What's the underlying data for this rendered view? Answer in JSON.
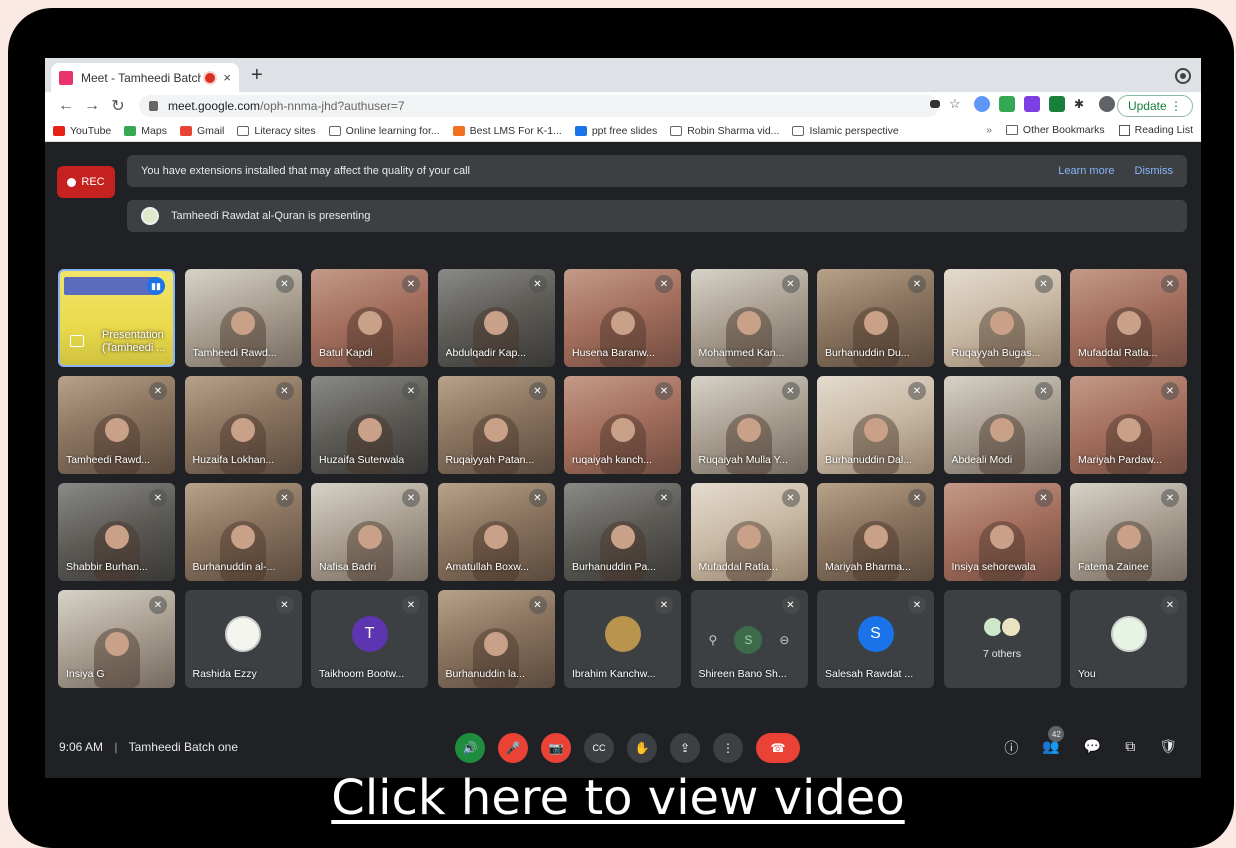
{
  "browser": {
    "tab_title": "Meet - Tamheedi Batch one",
    "tab_close": "×",
    "new_tab": "+",
    "url_host": "meet.google.com",
    "url_path": "/oph-nnma-jhd?authuser=7",
    "update_label": "Update",
    "bookmarks": [
      {
        "label": "YouTube",
        "icon": "youtube-icon",
        "color": "#e62117"
      },
      {
        "label": "Maps",
        "icon": "maps-icon",
        "color": "#34a853"
      },
      {
        "label": "Gmail",
        "icon": "gmail-icon",
        "color": "#ea4335"
      },
      {
        "label": "Literacy sites",
        "icon": "folder-icon"
      },
      {
        "label": "Online learning for...",
        "icon": "folder-icon"
      },
      {
        "label": "Best LMS For K-1...",
        "icon": "site-icon",
        "color": "#f37021"
      },
      {
        "label": "ppt free slides",
        "icon": "site-icon",
        "color": "#1a73e8"
      },
      {
        "label": "Robin Sharma vid...",
        "icon": "folder-icon"
      },
      {
        "label": "Islamic perspective",
        "icon": "folder-icon"
      }
    ],
    "bookmarks_overflow": "»",
    "other_bookmarks": "Other Bookmarks",
    "reading_list": "Reading List"
  },
  "meet": {
    "rec_label": "REC",
    "extension_notice": "You have extensions installed that may affect the quality of your call",
    "learn_more": "Learn more",
    "dismiss": "Dismiss",
    "presenting_notice": "Tamheedi Rawdat al-Quran is presenting",
    "presentation_tile_label": "Presentation (Tamheedi ...",
    "participants": [
      {
        "name": "Tamheedi Rawd...",
        "style": "v2"
      },
      {
        "name": "Batul Kapdi",
        "style": "v3"
      },
      {
        "name": "Abdulqadir Kap...",
        "style": "v4"
      },
      {
        "name": "Husena Baranw...",
        "style": "v3"
      },
      {
        "name": "Mohammed Kan...",
        "style": "v2"
      },
      {
        "name": "Burhanuddin Du...",
        "style": "v1"
      },
      {
        "name": "Ruqayyah Bugas...",
        "style": "v5"
      },
      {
        "name": "Mufaddal Ratla...",
        "style": "v3"
      },
      {
        "name": "Tamheedi Rawd...",
        "style": "v1"
      },
      {
        "name": "Huzaifa Lokhan...",
        "style": "v1"
      },
      {
        "name": "Huzaifa Suterwala",
        "style": "v4"
      },
      {
        "name": "Ruqaiyyah Patan...",
        "style": "v1"
      },
      {
        "name": "ruqaiyah kanch...",
        "style": "v3"
      },
      {
        "name": "Ruqaiyah Mulla Y...",
        "style": "v2"
      },
      {
        "name": "Burhanuddin Dal...",
        "style": "v5"
      },
      {
        "name": "Abdeali Modi",
        "style": "v2"
      },
      {
        "name": "Mariyah Pardaw...",
        "style": "v3"
      },
      {
        "name": "Shabbir Burhan...",
        "style": "v4"
      },
      {
        "name": "Burhanuddin al-...",
        "style": "v1"
      },
      {
        "name": "Nafisa Badri",
        "style": "v2"
      },
      {
        "name": "Amatullah Boxw...",
        "style": "v1"
      },
      {
        "name": "Burhanuddin Pa...",
        "style": "v4"
      },
      {
        "name": "Mufaddal Ratla...",
        "style": "v5"
      },
      {
        "name": "Mariyah Bharma...",
        "style": "v1"
      },
      {
        "name": "Insiya sehorewala",
        "style": "v3"
      },
      {
        "name": "Fatema Zainee",
        "style": "v2"
      },
      {
        "name": "Insiya G",
        "style": "v2"
      }
    ],
    "avatar_tiles": {
      "rashida": "Rashida Ezzy",
      "taikhoom": "Taikhoom Bootw...",
      "taikhoom_initial": "T",
      "burhanuddin_la": "Burhanuddin la...",
      "ibrahim": "Ibrahim Kanchw...",
      "shireen": "Shireen Bano Sh...",
      "shireen_initial": "S",
      "salesah": "Salesah Rawdat ...",
      "salesah_initial": "S",
      "others": "7 others",
      "you": "You"
    },
    "time": "9:06 AM",
    "meeting_name": "Tamheedi Batch one",
    "participant_count": "42"
  },
  "overlay": {
    "video_link": "Click here to view video"
  },
  "colors": {
    "meet_bg": "#202124",
    "tile_bg": "#3c4043",
    "rec_red": "#c5221f",
    "link_blue": "#8ab4f8",
    "end_call": "#ea4335"
  }
}
